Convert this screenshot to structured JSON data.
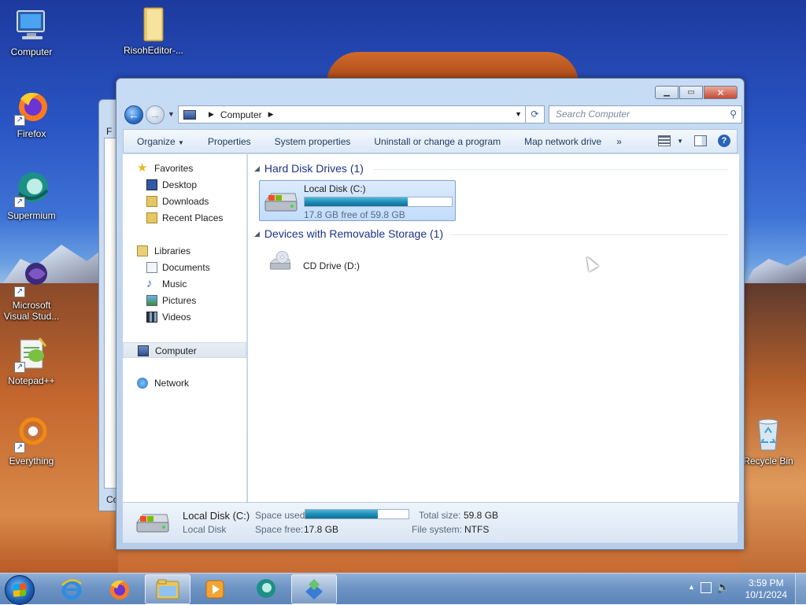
{
  "desktop": {
    "icons": [
      {
        "label": "Computer"
      },
      {
        "label": "RisohEditor-..."
      },
      {
        "label": "Firefox"
      },
      {
        "label": "Supermium"
      },
      {
        "label": "Microsoft Visual Stud..."
      },
      {
        "label": "Notepad++"
      },
      {
        "label": "Everything"
      },
      {
        "label": "Recycle Bin"
      }
    ]
  },
  "background_window": {
    "visible_text_top": "F",
    "visible_text_bottom": "Co"
  },
  "window": {
    "address": {
      "root": "Computer"
    },
    "search": {
      "placeholder": "Search Computer"
    },
    "toolbar": {
      "organize": "Organize",
      "properties": "Properties",
      "system_properties": "System properties",
      "uninstall": "Uninstall or change a program",
      "map_network_drive": "Map network drive",
      "overflow": "»"
    },
    "nav": {
      "favorites": "Favorites",
      "desktop": "Desktop",
      "downloads": "Downloads",
      "recent_places": "Recent Places",
      "libraries": "Libraries",
      "documents": "Documents",
      "music": "Music",
      "pictures": "Pictures",
      "videos": "Videos",
      "computer": "Computer",
      "network": "Network"
    },
    "groups": {
      "hdd": "Hard Disk Drives (1)",
      "removable": "Devices with Removable Storage (1)"
    },
    "drives": {
      "c": {
        "name": "Local Disk (C:)",
        "free_text": "17.8 GB free of 59.8 GB",
        "used_fraction": 0.7
      },
      "d": {
        "name": "CD Drive (D:)"
      }
    },
    "details": {
      "name": "Local Disk (C:)",
      "type": "Local Disk",
      "space_used_label": "Space used:",
      "space_free_label": "Space free:",
      "space_free_value": "17.8 GB",
      "total_size_label": "Total size:",
      "total_size_value": "59.8 GB",
      "file_system_label": "File system:",
      "file_system_value": "NTFS",
      "used_fraction": 0.7
    }
  },
  "taskbar": {
    "clock_time": "3:59 PM",
    "clock_date": "10/1/2024"
  },
  "colors": {
    "accent": "#1e8fb8",
    "group_header": "#1e3287",
    "selection": "#c1dcfc"
  }
}
